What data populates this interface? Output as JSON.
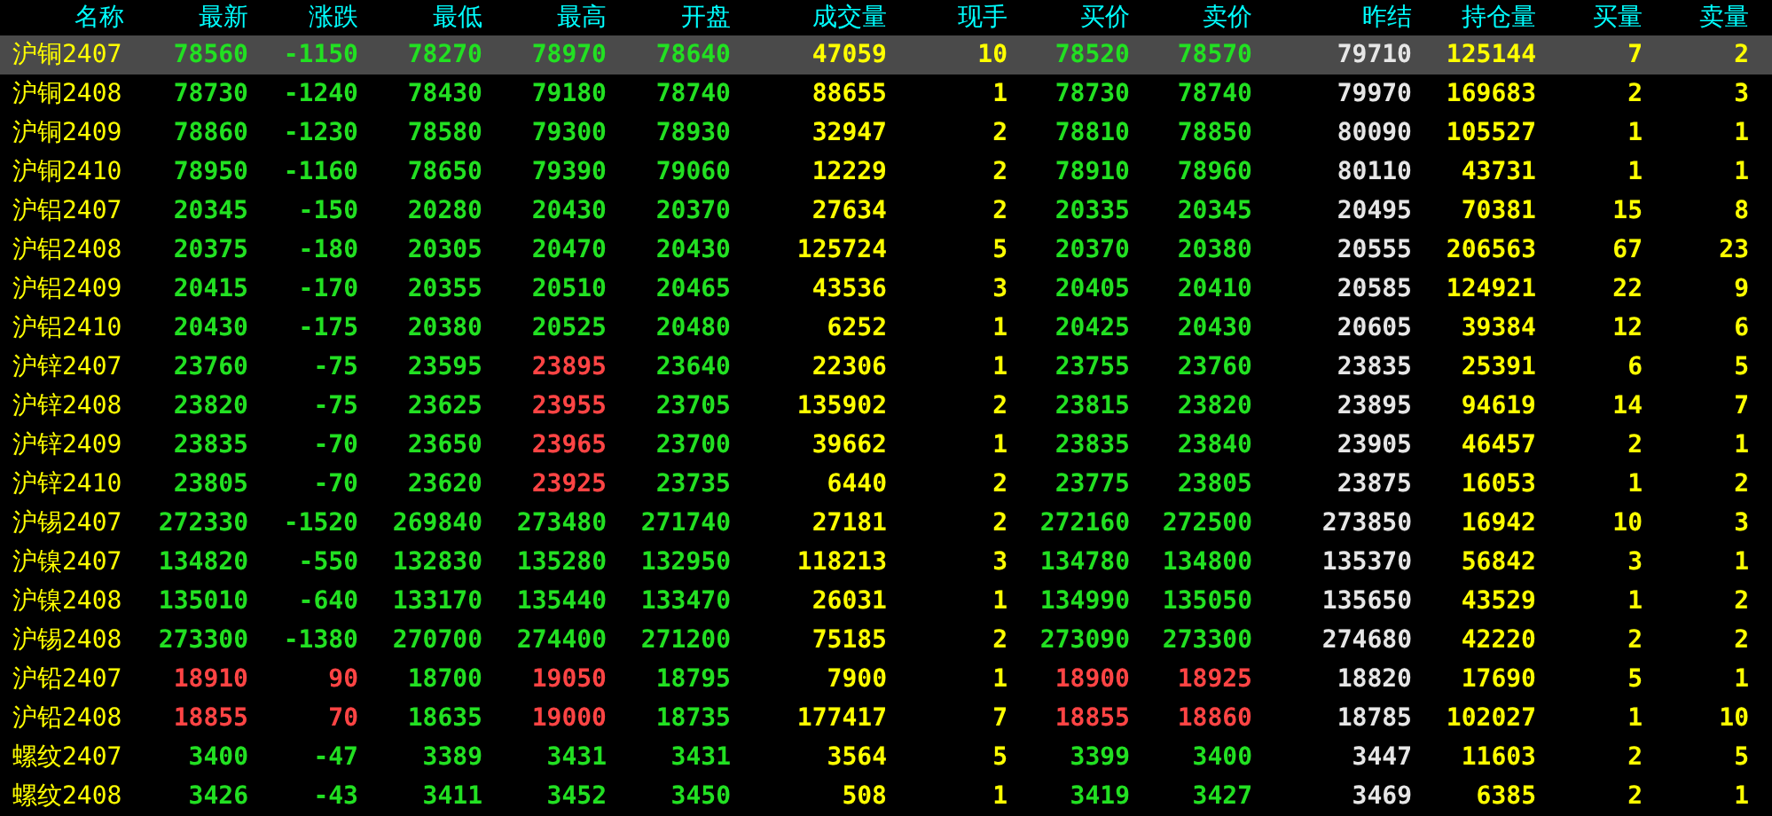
{
  "table": {
    "columns": [
      {
        "label": "名称"
      },
      {
        "label": "最新"
      },
      {
        "label": "涨跌"
      },
      {
        "label": "最低"
      },
      {
        "label": "最高"
      },
      {
        "label": "开盘"
      },
      {
        "label": "成交量"
      },
      {
        "label": "现手"
      },
      {
        "label": "买价"
      },
      {
        "label": "卖价"
      },
      {
        "label": "昨结"
      },
      {
        "label": "持仓量"
      },
      {
        "label": "买量"
      },
      {
        "label": "卖量"
      }
    ],
    "rows": [
      {
        "selected": true,
        "cells": [
          {
            "text": "沪铜2407",
            "color": "#ffff00"
          },
          {
            "text": "78560",
            "color": "#22e022"
          },
          {
            "text": "-1150",
            "color": "#22e022"
          },
          {
            "text": "78270",
            "color": "#22e022"
          },
          {
            "text": "78970",
            "color": "#22e022"
          },
          {
            "text": "78640",
            "color": "#22e022"
          },
          {
            "text": "47059",
            "color": "#ffff00"
          },
          {
            "text": "10",
            "color": "#ffff00"
          },
          {
            "text": "78520",
            "color": "#22e022"
          },
          {
            "text": "78570",
            "color": "#22e022"
          },
          {
            "text": "79710",
            "color": "#e6e6e6"
          },
          {
            "text": "125144",
            "color": "#ffff00"
          },
          {
            "text": "7",
            "color": "#ffff00"
          },
          {
            "text": "2",
            "color": "#ffff00"
          }
        ]
      },
      {
        "selected": false,
        "cells": [
          {
            "text": "沪铜2408",
            "color": "#ffff00"
          },
          {
            "text": "78730",
            "color": "#22e022"
          },
          {
            "text": "-1240",
            "color": "#22e022"
          },
          {
            "text": "78430",
            "color": "#22e022"
          },
          {
            "text": "79180",
            "color": "#22e022"
          },
          {
            "text": "78740",
            "color": "#22e022"
          },
          {
            "text": "88655",
            "color": "#ffff00"
          },
          {
            "text": "1",
            "color": "#ffff00"
          },
          {
            "text": "78730",
            "color": "#22e022"
          },
          {
            "text": "78740",
            "color": "#22e022"
          },
          {
            "text": "79970",
            "color": "#e6e6e6"
          },
          {
            "text": "169683",
            "color": "#ffff00"
          },
          {
            "text": "2",
            "color": "#ffff00"
          },
          {
            "text": "3",
            "color": "#ffff00"
          }
        ]
      },
      {
        "selected": false,
        "cells": [
          {
            "text": "沪铜2409",
            "color": "#ffff00"
          },
          {
            "text": "78860",
            "color": "#22e022"
          },
          {
            "text": "-1230",
            "color": "#22e022"
          },
          {
            "text": "78580",
            "color": "#22e022"
          },
          {
            "text": "79300",
            "color": "#22e022"
          },
          {
            "text": "78930",
            "color": "#22e022"
          },
          {
            "text": "32947",
            "color": "#ffff00"
          },
          {
            "text": "2",
            "color": "#ffff00"
          },
          {
            "text": "78810",
            "color": "#22e022"
          },
          {
            "text": "78850",
            "color": "#22e022"
          },
          {
            "text": "80090",
            "color": "#e6e6e6"
          },
          {
            "text": "105527",
            "color": "#ffff00"
          },
          {
            "text": "1",
            "color": "#ffff00"
          },
          {
            "text": "1",
            "color": "#ffff00"
          }
        ]
      },
      {
        "selected": false,
        "cells": [
          {
            "text": "沪铜2410",
            "color": "#ffff00"
          },
          {
            "text": "78950",
            "color": "#22e022"
          },
          {
            "text": "-1160",
            "color": "#22e022"
          },
          {
            "text": "78650",
            "color": "#22e022"
          },
          {
            "text": "79390",
            "color": "#22e022"
          },
          {
            "text": "79060",
            "color": "#22e022"
          },
          {
            "text": "12229",
            "color": "#ffff00"
          },
          {
            "text": "2",
            "color": "#ffff00"
          },
          {
            "text": "78910",
            "color": "#22e022"
          },
          {
            "text": "78960",
            "color": "#22e022"
          },
          {
            "text": "80110",
            "color": "#e6e6e6"
          },
          {
            "text": "43731",
            "color": "#ffff00"
          },
          {
            "text": "1",
            "color": "#ffff00"
          },
          {
            "text": "1",
            "color": "#ffff00"
          }
        ]
      },
      {
        "selected": false,
        "cells": [
          {
            "text": "沪铝2407",
            "color": "#ffff00"
          },
          {
            "text": "20345",
            "color": "#22e022"
          },
          {
            "text": "-150",
            "color": "#22e022"
          },
          {
            "text": "20280",
            "color": "#22e022"
          },
          {
            "text": "20430",
            "color": "#22e022"
          },
          {
            "text": "20370",
            "color": "#22e022"
          },
          {
            "text": "27634",
            "color": "#ffff00"
          },
          {
            "text": "2",
            "color": "#ffff00"
          },
          {
            "text": "20335",
            "color": "#22e022"
          },
          {
            "text": "20345",
            "color": "#22e022"
          },
          {
            "text": "20495",
            "color": "#e6e6e6"
          },
          {
            "text": "70381",
            "color": "#ffff00"
          },
          {
            "text": "15",
            "color": "#ffff00"
          },
          {
            "text": "8",
            "color": "#ffff00"
          }
        ]
      },
      {
        "selected": false,
        "cells": [
          {
            "text": "沪铝2408",
            "color": "#ffff00"
          },
          {
            "text": "20375",
            "color": "#22e022"
          },
          {
            "text": "-180",
            "color": "#22e022"
          },
          {
            "text": "20305",
            "color": "#22e022"
          },
          {
            "text": "20470",
            "color": "#22e022"
          },
          {
            "text": "20430",
            "color": "#22e022"
          },
          {
            "text": "125724",
            "color": "#ffff00"
          },
          {
            "text": "5",
            "color": "#ffff00"
          },
          {
            "text": "20370",
            "color": "#22e022"
          },
          {
            "text": "20380",
            "color": "#22e022"
          },
          {
            "text": "20555",
            "color": "#e6e6e6"
          },
          {
            "text": "206563",
            "color": "#ffff00"
          },
          {
            "text": "67",
            "color": "#ffff00"
          },
          {
            "text": "23",
            "color": "#ffff00"
          }
        ]
      },
      {
        "selected": false,
        "cells": [
          {
            "text": "沪铝2409",
            "color": "#ffff00"
          },
          {
            "text": "20415",
            "color": "#22e022"
          },
          {
            "text": "-170",
            "color": "#22e022"
          },
          {
            "text": "20355",
            "color": "#22e022"
          },
          {
            "text": "20510",
            "color": "#22e022"
          },
          {
            "text": "20465",
            "color": "#22e022"
          },
          {
            "text": "43536",
            "color": "#ffff00"
          },
          {
            "text": "3",
            "color": "#ffff00"
          },
          {
            "text": "20405",
            "color": "#22e022"
          },
          {
            "text": "20410",
            "color": "#22e022"
          },
          {
            "text": "20585",
            "color": "#e6e6e6"
          },
          {
            "text": "124921",
            "color": "#ffff00"
          },
          {
            "text": "22",
            "color": "#ffff00"
          },
          {
            "text": "9",
            "color": "#ffff00"
          }
        ]
      },
      {
        "selected": false,
        "cells": [
          {
            "text": "沪铝2410",
            "color": "#ffff00"
          },
          {
            "text": "20430",
            "color": "#22e022"
          },
          {
            "text": "-175",
            "color": "#22e022"
          },
          {
            "text": "20380",
            "color": "#22e022"
          },
          {
            "text": "20525",
            "color": "#22e022"
          },
          {
            "text": "20480",
            "color": "#22e022"
          },
          {
            "text": "6252",
            "color": "#ffff00"
          },
          {
            "text": "1",
            "color": "#ffff00"
          },
          {
            "text": "20425",
            "color": "#22e022"
          },
          {
            "text": "20430",
            "color": "#22e022"
          },
          {
            "text": "20605",
            "color": "#e6e6e6"
          },
          {
            "text": "39384",
            "color": "#ffff00"
          },
          {
            "text": "12",
            "color": "#ffff00"
          },
          {
            "text": "6",
            "color": "#ffff00"
          }
        ]
      },
      {
        "selected": false,
        "cells": [
          {
            "text": "沪锌2407",
            "color": "#ffff00"
          },
          {
            "text": "23760",
            "color": "#22e022"
          },
          {
            "text": "-75",
            "color": "#22e022"
          },
          {
            "text": "23595",
            "color": "#22e022"
          },
          {
            "text": "23895",
            "color": "#ff4444"
          },
          {
            "text": "23640",
            "color": "#22e022"
          },
          {
            "text": "22306",
            "color": "#ffff00"
          },
          {
            "text": "1",
            "color": "#ffff00"
          },
          {
            "text": "23755",
            "color": "#22e022"
          },
          {
            "text": "23760",
            "color": "#22e022"
          },
          {
            "text": "23835",
            "color": "#e6e6e6"
          },
          {
            "text": "25391",
            "color": "#ffff00"
          },
          {
            "text": "6",
            "color": "#ffff00"
          },
          {
            "text": "5",
            "color": "#ffff00"
          }
        ]
      },
      {
        "selected": false,
        "cells": [
          {
            "text": "沪锌2408",
            "color": "#ffff00"
          },
          {
            "text": "23820",
            "color": "#22e022"
          },
          {
            "text": "-75",
            "color": "#22e022"
          },
          {
            "text": "23625",
            "color": "#22e022"
          },
          {
            "text": "23955",
            "color": "#ff4444"
          },
          {
            "text": "23705",
            "color": "#22e022"
          },
          {
            "text": "135902",
            "color": "#ffff00"
          },
          {
            "text": "2",
            "color": "#ffff00"
          },
          {
            "text": "23815",
            "color": "#22e022"
          },
          {
            "text": "23820",
            "color": "#22e022"
          },
          {
            "text": "23895",
            "color": "#e6e6e6"
          },
          {
            "text": "94619",
            "color": "#ffff00"
          },
          {
            "text": "14",
            "color": "#ffff00"
          },
          {
            "text": "7",
            "color": "#ffff00"
          }
        ]
      },
      {
        "selected": false,
        "cells": [
          {
            "text": "沪锌2409",
            "color": "#ffff00"
          },
          {
            "text": "23835",
            "color": "#22e022"
          },
          {
            "text": "-70",
            "color": "#22e022"
          },
          {
            "text": "23650",
            "color": "#22e022"
          },
          {
            "text": "23965",
            "color": "#ff4444"
          },
          {
            "text": "23700",
            "color": "#22e022"
          },
          {
            "text": "39662",
            "color": "#ffff00"
          },
          {
            "text": "1",
            "color": "#ffff00"
          },
          {
            "text": "23835",
            "color": "#22e022"
          },
          {
            "text": "23840",
            "color": "#22e022"
          },
          {
            "text": "23905",
            "color": "#e6e6e6"
          },
          {
            "text": "46457",
            "color": "#ffff00"
          },
          {
            "text": "2",
            "color": "#ffff00"
          },
          {
            "text": "1",
            "color": "#ffff00"
          }
        ]
      },
      {
        "selected": false,
        "cells": [
          {
            "text": "沪锌2410",
            "color": "#ffff00"
          },
          {
            "text": "23805",
            "color": "#22e022"
          },
          {
            "text": "-70",
            "color": "#22e022"
          },
          {
            "text": "23620",
            "color": "#22e022"
          },
          {
            "text": "23925",
            "color": "#ff4444"
          },
          {
            "text": "23735",
            "color": "#22e022"
          },
          {
            "text": "6440",
            "color": "#ffff00"
          },
          {
            "text": "2",
            "color": "#ffff00"
          },
          {
            "text": "23775",
            "color": "#22e022"
          },
          {
            "text": "23805",
            "color": "#22e022"
          },
          {
            "text": "23875",
            "color": "#e6e6e6"
          },
          {
            "text": "16053",
            "color": "#ffff00"
          },
          {
            "text": "1",
            "color": "#ffff00"
          },
          {
            "text": "2",
            "color": "#ffff00"
          }
        ]
      },
      {
        "selected": false,
        "cells": [
          {
            "text": "沪锡2407",
            "color": "#ffff00"
          },
          {
            "text": "272330",
            "color": "#22e022"
          },
          {
            "text": "-1520",
            "color": "#22e022"
          },
          {
            "text": "269840",
            "color": "#22e022"
          },
          {
            "text": "273480",
            "color": "#22e022"
          },
          {
            "text": "271740",
            "color": "#22e022"
          },
          {
            "text": "27181",
            "color": "#ffff00"
          },
          {
            "text": "2",
            "color": "#ffff00"
          },
          {
            "text": "272160",
            "color": "#22e022"
          },
          {
            "text": "272500",
            "color": "#22e022"
          },
          {
            "text": "273850",
            "color": "#e6e6e6"
          },
          {
            "text": "16942",
            "color": "#ffff00"
          },
          {
            "text": "10",
            "color": "#ffff00"
          },
          {
            "text": "3",
            "color": "#ffff00"
          }
        ]
      },
      {
        "selected": false,
        "cells": [
          {
            "text": "沪镍2407",
            "color": "#ffff00"
          },
          {
            "text": "134820",
            "color": "#22e022"
          },
          {
            "text": "-550",
            "color": "#22e022"
          },
          {
            "text": "132830",
            "color": "#22e022"
          },
          {
            "text": "135280",
            "color": "#22e022"
          },
          {
            "text": "132950",
            "color": "#22e022"
          },
          {
            "text": "118213",
            "color": "#ffff00"
          },
          {
            "text": "3",
            "color": "#ffff00"
          },
          {
            "text": "134780",
            "color": "#22e022"
          },
          {
            "text": "134800",
            "color": "#22e022"
          },
          {
            "text": "135370",
            "color": "#e6e6e6"
          },
          {
            "text": "56842",
            "color": "#ffff00"
          },
          {
            "text": "3",
            "color": "#ffff00"
          },
          {
            "text": "1",
            "color": "#ffff00"
          }
        ]
      },
      {
        "selected": false,
        "cells": [
          {
            "text": "沪镍2408",
            "color": "#ffff00"
          },
          {
            "text": "135010",
            "color": "#22e022"
          },
          {
            "text": "-640",
            "color": "#22e022"
          },
          {
            "text": "133170",
            "color": "#22e022"
          },
          {
            "text": "135440",
            "color": "#22e022"
          },
          {
            "text": "133470",
            "color": "#22e022"
          },
          {
            "text": "26031",
            "color": "#ffff00"
          },
          {
            "text": "1",
            "color": "#ffff00"
          },
          {
            "text": "134990",
            "color": "#22e022"
          },
          {
            "text": "135050",
            "color": "#22e022"
          },
          {
            "text": "135650",
            "color": "#e6e6e6"
          },
          {
            "text": "43529",
            "color": "#ffff00"
          },
          {
            "text": "1",
            "color": "#ffff00"
          },
          {
            "text": "2",
            "color": "#ffff00"
          }
        ]
      },
      {
        "selected": false,
        "cells": [
          {
            "text": "沪锡2408",
            "color": "#ffff00"
          },
          {
            "text": "273300",
            "color": "#22e022"
          },
          {
            "text": "-1380",
            "color": "#22e022"
          },
          {
            "text": "270700",
            "color": "#22e022"
          },
          {
            "text": "274400",
            "color": "#22e022"
          },
          {
            "text": "271200",
            "color": "#22e022"
          },
          {
            "text": "75185",
            "color": "#ffff00"
          },
          {
            "text": "2",
            "color": "#ffff00"
          },
          {
            "text": "273090",
            "color": "#22e022"
          },
          {
            "text": "273300",
            "color": "#22e022"
          },
          {
            "text": "274680",
            "color": "#e6e6e6"
          },
          {
            "text": "42220",
            "color": "#ffff00"
          },
          {
            "text": "2",
            "color": "#ffff00"
          },
          {
            "text": "2",
            "color": "#ffff00"
          }
        ]
      },
      {
        "selected": false,
        "cells": [
          {
            "text": "沪铅2407",
            "color": "#ffff00"
          },
          {
            "text": "18910",
            "color": "#ff4444"
          },
          {
            "text": "90",
            "color": "#ff4444"
          },
          {
            "text": "18700",
            "color": "#22e022"
          },
          {
            "text": "19050",
            "color": "#ff4444"
          },
          {
            "text": "18795",
            "color": "#22e022"
          },
          {
            "text": "7900",
            "color": "#ffff00"
          },
          {
            "text": "1",
            "color": "#ffff00"
          },
          {
            "text": "18900",
            "color": "#ff4444"
          },
          {
            "text": "18925",
            "color": "#ff4444"
          },
          {
            "text": "18820",
            "color": "#e6e6e6"
          },
          {
            "text": "17690",
            "color": "#ffff00"
          },
          {
            "text": "5",
            "color": "#ffff00"
          },
          {
            "text": "1",
            "color": "#ffff00"
          }
        ]
      },
      {
        "selected": false,
        "cells": [
          {
            "text": "沪铅2408",
            "color": "#ffff00"
          },
          {
            "text": "18855",
            "color": "#ff4444"
          },
          {
            "text": "70",
            "color": "#ff4444"
          },
          {
            "text": "18635",
            "color": "#22e022"
          },
          {
            "text": "19000",
            "color": "#ff4444"
          },
          {
            "text": "18735",
            "color": "#22e022"
          },
          {
            "text": "177417",
            "color": "#ffff00"
          },
          {
            "text": "7",
            "color": "#ffff00"
          },
          {
            "text": "18855",
            "color": "#ff4444"
          },
          {
            "text": "18860",
            "color": "#ff4444"
          },
          {
            "text": "18785",
            "color": "#e6e6e6"
          },
          {
            "text": "102027",
            "color": "#ffff00"
          },
          {
            "text": "1",
            "color": "#ffff00"
          },
          {
            "text": "10",
            "color": "#ffff00"
          }
        ]
      },
      {
        "selected": false,
        "cells": [
          {
            "text": "螺纹2407",
            "color": "#ffff00"
          },
          {
            "text": "3400",
            "color": "#22e022"
          },
          {
            "text": "-47",
            "color": "#22e022"
          },
          {
            "text": "3389",
            "color": "#22e022"
          },
          {
            "text": "3431",
            "color": "#22e022"
          },
          {
            "text": "3431",
            "color": "#22e022"
          },
          {
            "text": "3564",
            "color": "#ffff00"
          },
          {
            "text": "5",
            "color": "#ffff00"
          },
          {
            "text": "3399",
            "color": "#22e022"
          },
          {
            "text": "3400",
            "color": "#22e022"
          },
          {
            "text": "3447",
            "color": "#e6e6e6"
          },
          {
            "text": "11603",
            "color": "#ffff00"
          },
          {
            "text": "2",
            "color": "#ffff00"
          },
          {
            "text": "5",
            "color": "#ffff00"
          }
        ]
      },
      {
        "selected": false,
        "cells": [
          {
            "text": "螺纹2408",
            "color": "#ffff00"
          },
          {
            "text": "3426",
            "color": "#22e022"
          },
          {
            "text": "-43",
            "color": "#22e022"
          },
          {
            "text": "3411",
            "color": "#22e022"
          },
          {
            "text": "3452",
            "color": "#22e022"
          },
          {
            "text": "3450",
            "color": "#22e022"
          },
          {
            "text": "508",
            "color": "#ffff00"
          },
          {
            "text": "1",
            "color": "#ffff00"
          },
          {
            "text": "3419",
            "color": "#22e022"
          },
          {
            "text": "3427",
            "color": "#22e022"
          },
          {
            "text": "3469",
            "color": "#e6e6e6"
          },
          {
            "text": "6385",
            "color": "#ffff00"
          },
          {
            "text": "2",
            "color": "#ffff00"
          },
          {
            "text": "1",
            "color": "#ffff00"
          }
        ]
      }
    ]
  }
}
